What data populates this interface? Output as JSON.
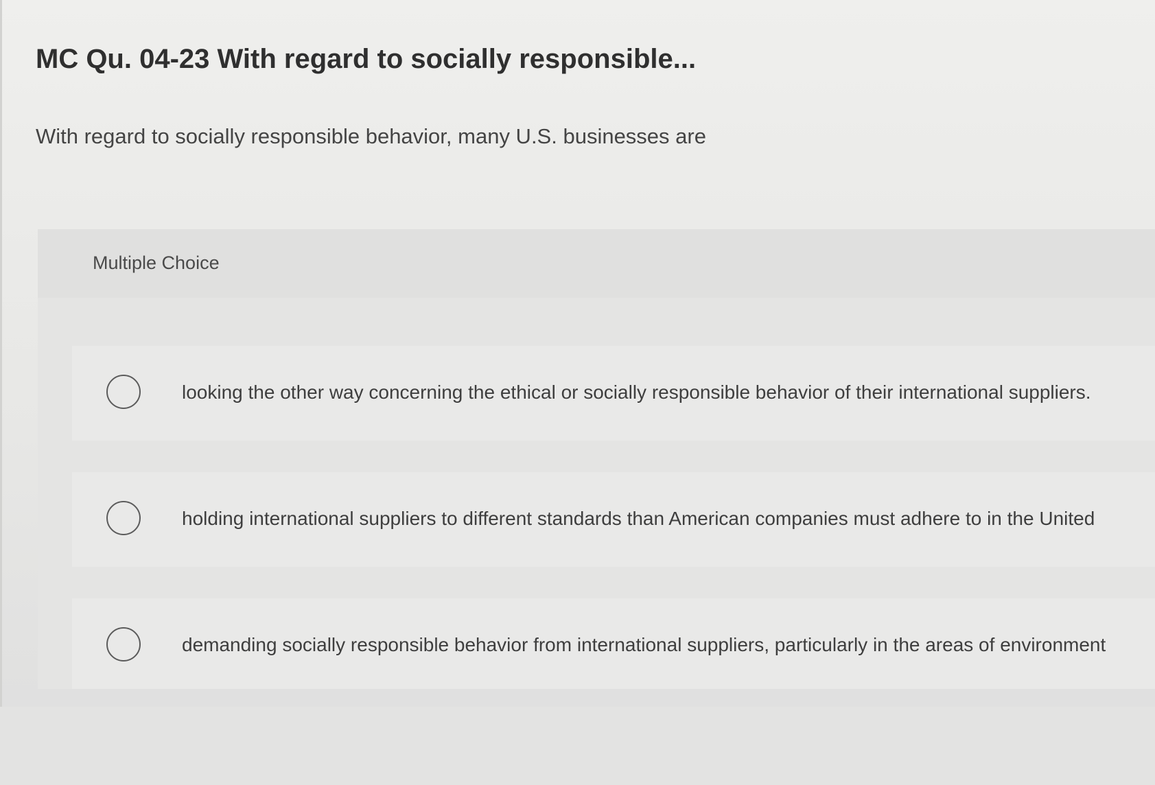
{
  "question": {
    "title": "MC Qu. 04-23 With regard to socially responsible...",
    "prompt": "With regard to socially responsible behavior, many U.S. businesses are"
  },
  "multiple_choice": {
    "label": "Multiple Choice",
    "options": [
      {
        "text": "looking the other way concerning the ethical or socially responsible behavior of their international suppliers.",
        "selected": false
      },
      {
        "text": "holding international suppliers to different standards than American companies must adhere to in the United",
        "selected": false
      },
      {
        "text": "demanding socially responsible behavior from international suppliers, particularly in the areas of environment",
        "selected": false
      }
    ]
  }
}
